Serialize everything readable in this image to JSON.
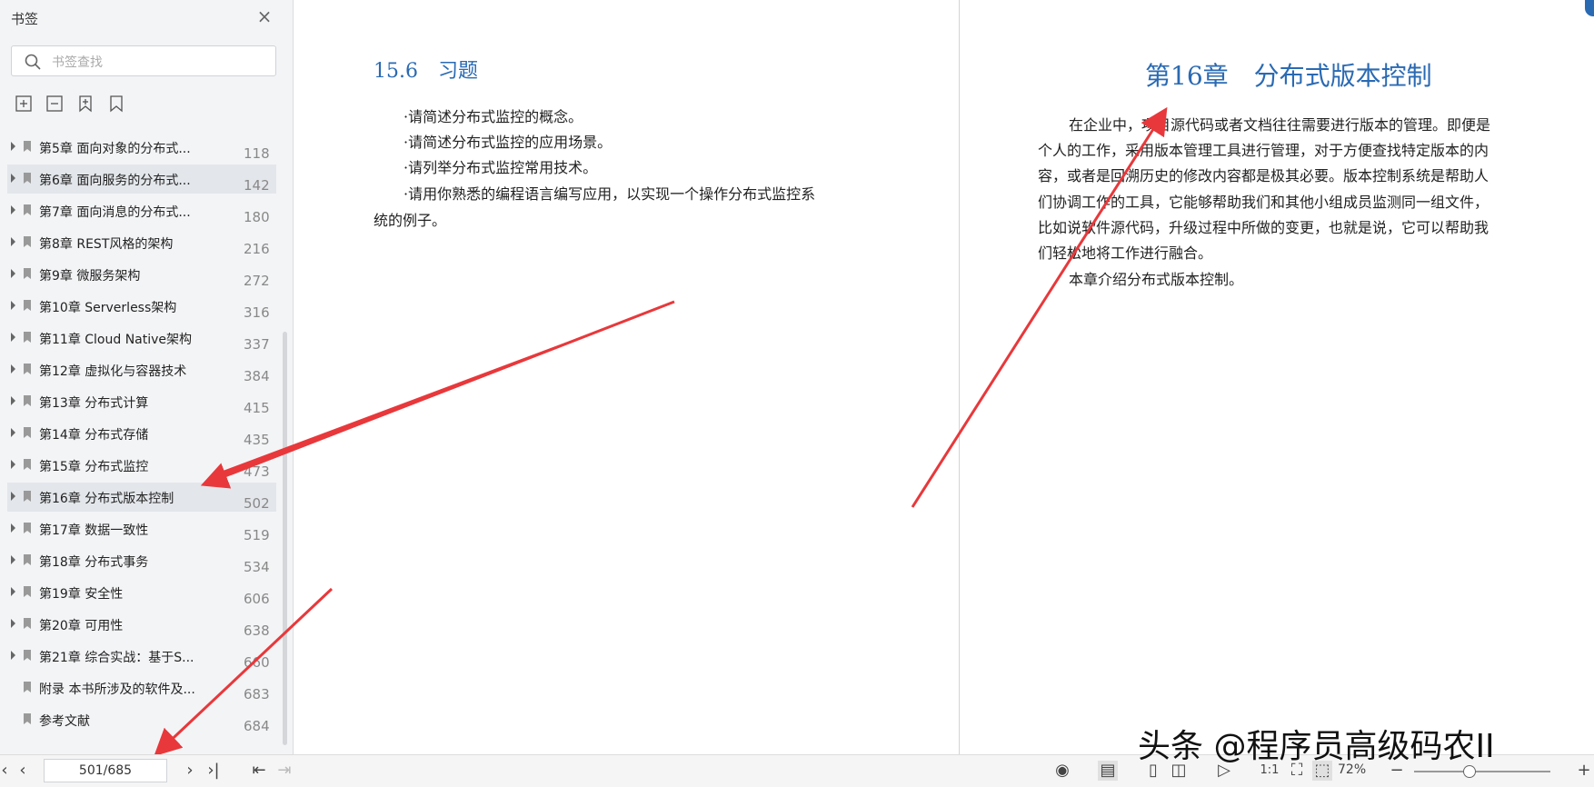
{
  "sidebar": {
    "title": "书签",
    "search_placeholder": "书签查找",
    "items": [
      {
        "label": "第5章 面向对象的分布式...",
        "page": "118",
        "expandable": true
      },
      {
        "label": "第6章 面向服务的分布式...",
        "page": "142",
        "expandable": true
      },
      {
        "label": "第7章 面向消息的分布式...",
        "page": "180",
        "expandable": true
      },
      {
        "label": "第8章 REST风格的架构",
        "page": "216",
        "expandable": true
      },
      {
        "label": "第9章 微服务架构",
        "page": "272",
        "expandable": true
      },
      {
        "label": "第10章 Serverless架构",
        "page": "316",
        "expandable": true
      },
      {
        "label": "第11章 Cloud Native架构",
        "page": "337",
        "expandable": true
      },
      {
        "label": "第12章 虚拟化与容器技术",
        "page": "384",
        "expandable": true
      },
      {
        "label": "第13章 分布式计算",
        "page": "415",
        "expandable": true
      },
      {
        "label": "第14章 分布式存储",
        "page": "435",
        "expandable": true
      },
      {
        "label": "第15章 分布式监控",
        "page": "473",
        "expandable": true
      },
      {
        "label": "第16章 分布式版本控制",
        "page": "502",
        "expandable": true
      },
      {
        "label": "第17章 数据一致性",
        "page": "519",
        "expandable": true
      },
      {
        "label": "第18章 分布式事务",
        "page": "534",
        "expandable": true
      },
      {
        "label": "第19章 安全性",
        "page": "606",
        "expandable": true
      },
      {
        "label": "第20章 可用性",
        "page": "638",
        "expandable": true
      },
      {
        "label": "第21章 综合实战：基于S...",
        "page": "660",
        "expandable": true
      },
      {
        "label": "附录 本书所涉及的软件及...",
        "page": "683",
        "expandable": false
      },
      {
        "label": "参考文献",
        "page": "684",
        "expandable": false
      }
    ]
  },
  "left_page": {
    "heading": "15.6　习题",
    "lines": [
      "·请简述分布式监控的概念。",
      "·请简述分布式监控的应用场景。",
      "·请列举分布式监控常用技术。",
      "·请用你熟悉的编程语言编写应用，以实现一个操作分布式监控系",
      "统的例子。"
    ]
  },
  "right_page": {
    "heading": "第16章　分布式版本控制",
    "lines": [
      "在企业中，项目源代码或者文档往往需要进行版本的管理。即便是",
      "个人的工作，采用版本管理工具进行管理，对于方便查找特定版本的内",
      "容，或者是回溯历史的修改内容都是极其必要。版本控制系统是帮助人",
      "们协调工作的工具，它能够帮助我们和其他小组成员监测同一组文件，",
      "比如说软件源代码，升级过程中所做的变更，也就是说，它可以帮助我",
      "们轻松地将工作进行融合。",
      "本章介绍分布式版本控制。"
    ]
  },
  "bottombar": {
    "page_value": "501/685",
    "zoom": "72%",
    "zoom_fraction": 0.36
  },
  "watermark": "头条 @程序员高级码农II",
  "colors": {
    "accent": "#2a6ab3",
    "arrow": "#e8383b",
    "highlight": "#e3e6ea"
  }
}
